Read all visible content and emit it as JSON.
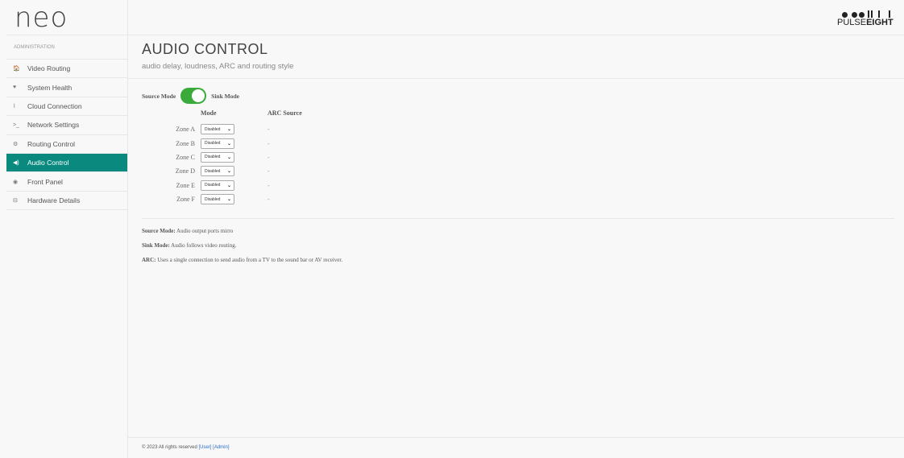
{
  "app": {
    "logo": "neo",
    "brand_main": "PULSE",
    "brand_bold": "EIGHT"
  },
  "sidebar": {
    "header": "ADMINISTRATION",
    "items": [
      {
        "label": "Video Routing",
        "icon": "home-icon",
        "glyph": "🏠"
      },
      {
        "label": "System Health",
        "icon": "heart-icon",
        "glyph": "♥"
      },
      {
        "label": "Cloud Connection",
        "icon": "rss-icon",
        "glyph": "⌇"
      },
      {
        "label": "Network Settings",
        "icon": "terminal-icon",
        "glyph": ">_"
      },
      {
        "label": "Routing Control",
        "icon": "cogs-icon",
        "glyph": "⚙"
      },
      {
        "label": "Audio Control",
        "icon": "volume-icon",
        "glyph": "◀)"
      },
      {
        "label": "Front Panel",
        "icon": "circle-icon",
        "glyph": "◉"
      },
      {
        "label": "Hardware Details",
        "icon": "hdd-icon",
        "glyph": "⊟"
      }
    ],
    "active_index": 5
  },
  "page": {
    "title": "AUDIO CONTROL",
    "subtitle": "audio delay, loudness, ARC and routing style"
  },
  "mode": {
    "source_label": "Source Mode",
    "sink_label": "Sink Mode",
    "toggle_color": "#3aaa3a"
  },
  "zones": {
    "headers": {
      "mode": "Mode",
      "arc": "ARC Source"
    },
    "rows": [
      {
        "zone": "Zone A",
        "mode": "Disabled",
        "arc": "-"
      },
      {
        "zone": "Zone B",
        "mode": "Disabled",
        "arc": "-"
      },
      {
        "zone": "Zone C",
        "mode": "Disabled",
        "arc": "-"
      },
      {
        "zone": "Zone D",
        "mode": "Disabled",
        "arc": "-"
      },
      {
        "zone": "Zone E",
        "mode": "Disabled",
        "arc": "-"
      },
      {
        "zone": "Zone F",
        "mode": "Disabled",
        "arc": "-"
      }
    ]
  },
  "notes": [
    {
      "term": "Source Mode:",
      "text": " Audio output ports mirro"
    },
    {
      "term": "Sink Mode:",
      "text": " Audio follows video routing."
    },
    {
      "term": "ARC:",
      "text": " Uses a single connection to send audio from a TV to the sound bar or AV receiver."
    }
  ],
  "footer": {
    "text": "© 2023 All rights reserved ",
    "user_link": "[User]",
    "admin_link": "[Admin]"
  },
  "colors": {
    "accent": "#0a8a7f",
    "link": "#2a6ec8"
  }
}
